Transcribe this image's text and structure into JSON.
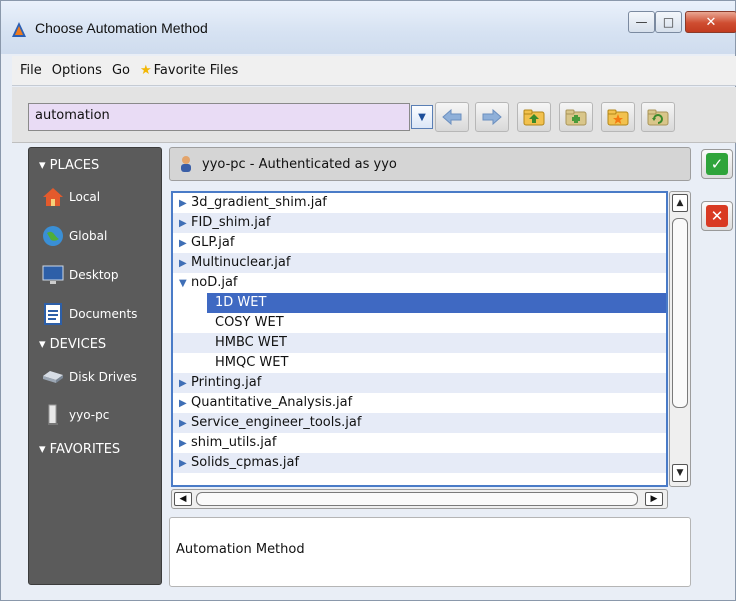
{
  "window": {
    "title": "Choose Automation Method",
    "controls": {
      "minimize": "—",
      "maximize": "□",
      "close": "✕"
    }
  },
  "menubar": {
    "items": [
      "File",
      "Options",
      "Go"
    ],
    "favorite_files": "Favorite Files"
  },
  "toolbar": {
    "location_value": "automation",
    "icons": [
      "back-arrow-icon",
      "forward-arrow-icon",
      "folder-up-icon",
      "folder-new-icon",
      "folder-favorite-icon",
      "folder-refresh-icon"
    ]
  },
  "sidebar": {
    "places_header": "PLACES",
    "places": [
      "Local",
      "Global",
      "Desktop",
      "Documents"
    ],
    "devices_header": "DEVICES",
    "devices": [
      "Disk Drives",
      "yyo-pc"
    ],
    "favorites_header": "FAVORITES"
  },
  "auth": {
    "text": "yyo-pc - Authenticated as yyo"
  },
  "tree": {
    "items": [
      {
        "label": "3d_gradient_shim.jaf",
        "type": "collapsed"
      },
      {
        "label": "FID_shim.jaf",
        "type": "collapsed"
      },
      {
        "label": "GLP.jaf",
        "type": "collapsed"
      },
      {
        "label": "Multinuclear.jaf",
        "type": "collapsed"
      },
      {
        "label": "noD.jaf",
        "type": "expanded"
      },
      {
        "label": "1D WET",
        "type": "child",
        "selected": true
      },
      {
        "label": "COSY WET",
        "type": "child"
      },
      {
        "label": "HMBC WET",
        "type": "child"
      },
      {
        "label": "HMQC WET",
        "type": "child"
      },
      {
        "label": "Printing.jaf",
        "type": "collapsed"
      },
      {
        "label": "Quantitative_Analysis.jaf",
        "type": "collapsed"
      },
      {
        "label": "Service_engineer_tools.jaf",
        "type": "collapsed"
      },
      {
        "label": "shim_utils.jaf",
        "type": "collapsed"
      },
      {
        "label": "Solids_cpmas.jaf",
        "type": "collapsed"
      }
    ]
  },
  "description": {
    "text": "Automation Method"
  },
  "colors": {
    "selection": "#3f69c2",
    "combo_bg": "#e9dcf5",
    "sidebar_bg": "#5b5b5b",
    "ok_green": "#2fa43a",
    "cancel_red": "#d93a22"
  }
}
